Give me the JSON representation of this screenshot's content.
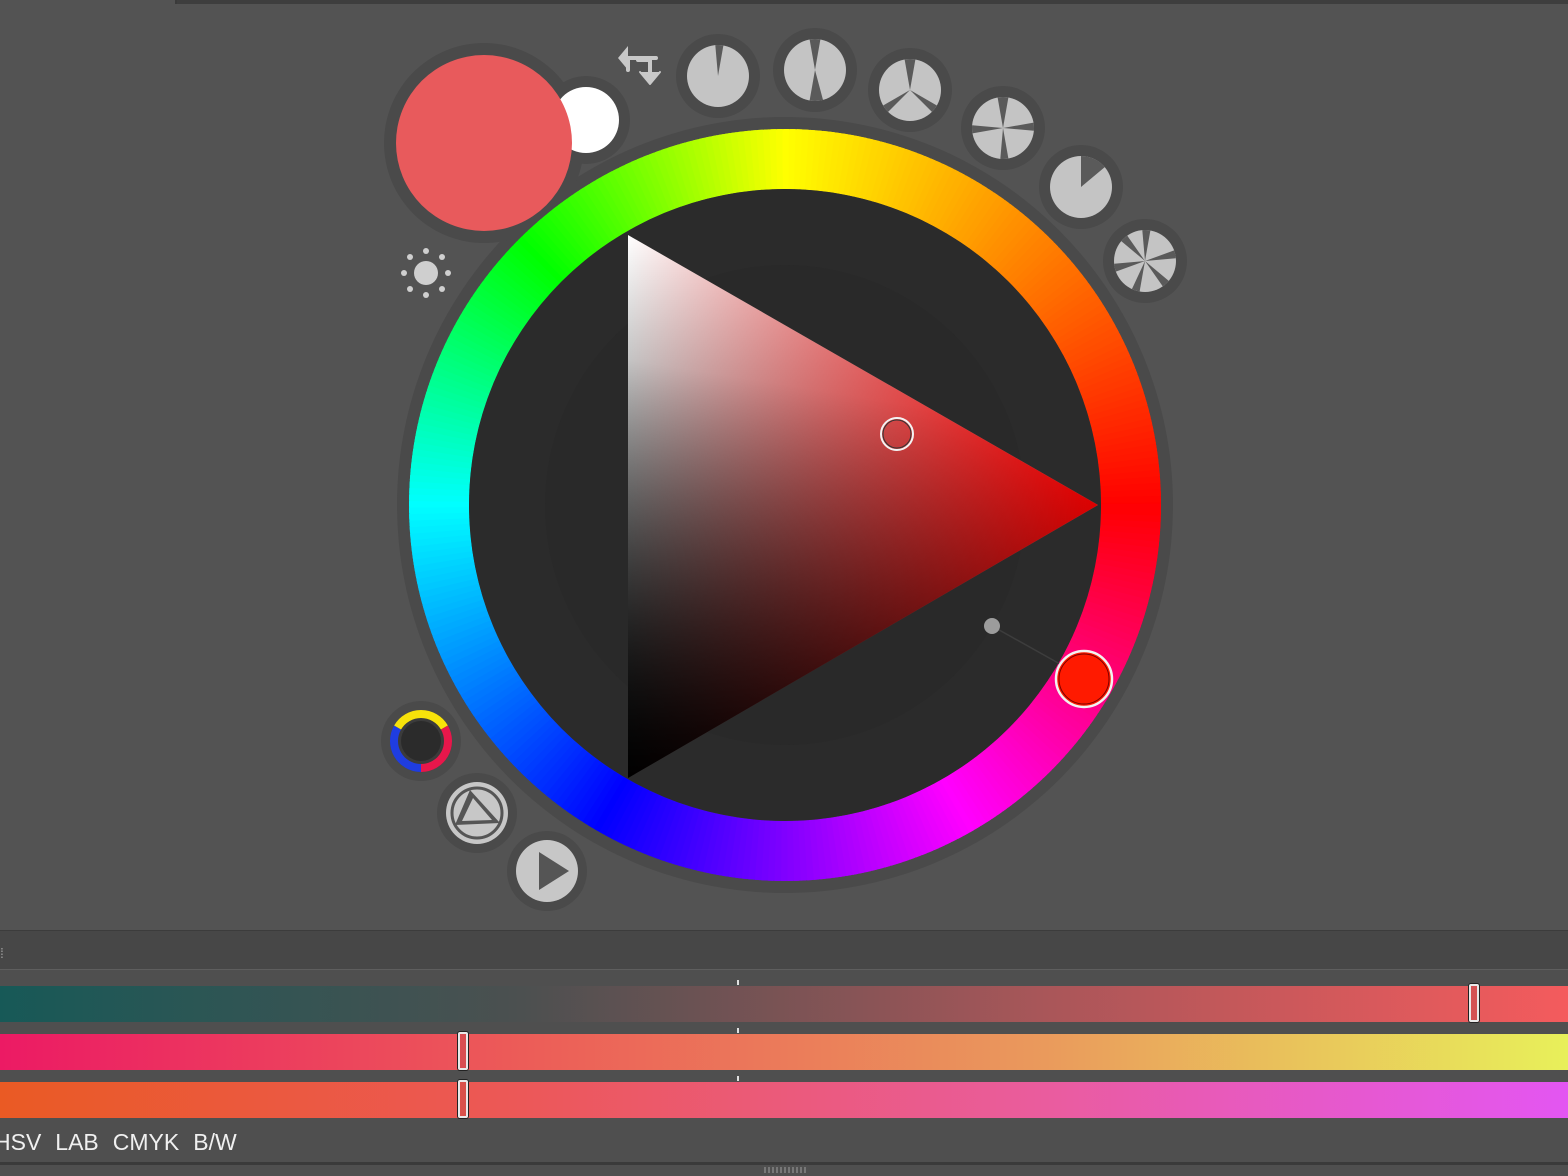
{
  "colors": {
    "foreground": "#e85a5c",
    "background": "#ffffff",
    "hue_handle": "#ff1a00",
    "panel_bg": "#535353",
    "wheel_inner": "#2b2b2b"
  },
  "icons": [
    "swap-colors-icon",
    "harmony-complementary-icon",
    "harmony-split-icon",
    "harmony-triad-icon",
    "harmony-tetrad-icon",
    "harmony-analogous-icon",
    "harmony-custom-icon",
    "brightness-icon",
    "color-model-ryb-icon",
    "triangle-mode-icon",
    "play-icon"
  ],
  "sliders": {
    "values": [
      0.94,
      0.295,
      0.295
    ],
    "gradients": [
      [
        "#175957",
        "#4c5050",
        "#a95659",
        "#f45b5d"
      ],
      [
        "#ec1a64",
        "#ec5c58",
        "#ea9a5c",
        "#e8f05a"
      ],
      [
        "#ea5a24",
        "#ec5858",
        "#ea5c9e",
        "#e356f2"
      ]
    ]
  },
  "modes": [
    "HSV",
    "LAB",
    "CMYK",
    "B/W"
  ],
  "tab_handle": "⁞"
}
